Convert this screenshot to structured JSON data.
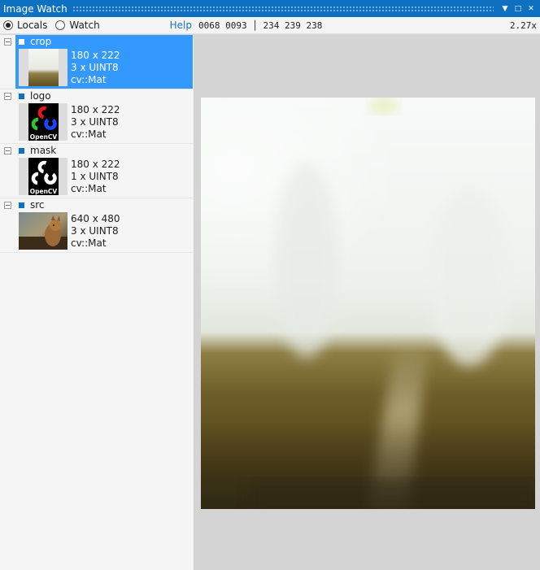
{
  "window": {
    "title": "Image Watch"
  },
  "titlebar_buttons": {
    "dropdown": "▼",
    "maximize": "□",
    "close": "✕"
  },
  "toolbar": {
    "locals_label": "Locals",
    "watch_label": "Watch",
    "help_label": "Help",
    "pixel_coords": "0068 0093 │ 234 239 238",
    "zoom": "2.27x"
  },
  "variables": [
    {
      "name": "crop",
      "size": "180 x 222",
      "type": "3 x UINT8",
      "class": "cv::Mat",
      "selected": true
    },
    {
      "name": "logo",
      "size": "180 x 222",
      "type": "3 x UINT8",
      "class": "cv::Mat",
      "selected": false
    },
    {
      "name": "mask",
      "size": "180 x 222",
      "type": "1 x UINT8",
      "class": "cv::Mat",
      "selected": false
    },
    {
      "name": "src",
      "size": "640 x 480",
      "type": "3 x UINT8",
      "class": "cv::Mat",
      "selected": false
    }
  ],
  "icons": {
    "expander": "minus-box-icon",
    "bullet": "variable-square-icon"
  },
  "colors": {
    "accent": "#0e70c0",
    "selection": "#3399ff",
    "help_link": "#1a73c7"
  }
}
